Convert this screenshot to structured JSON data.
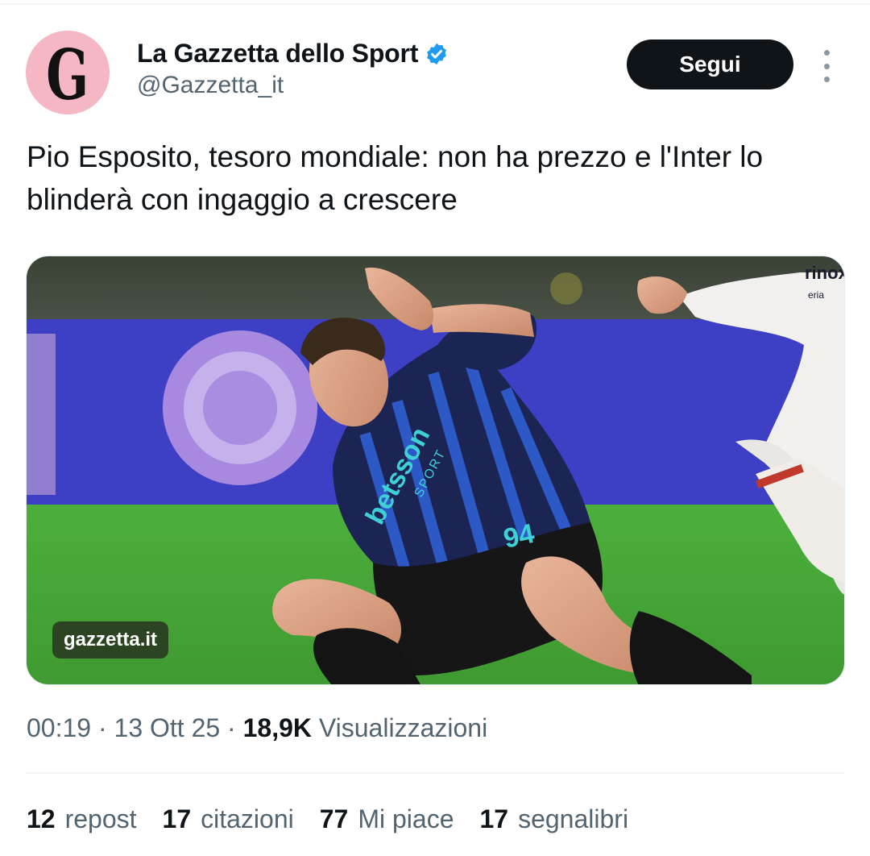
{
  "account": {
    "avatar_letter": "G",
    "display_name": "La Gazzetta dello Sport",
    "handle": "@Gazzetta_it",
    "verified": true,
    "avatar_color": "#f4b7c3",
    "verified_color": "#1d9bf0"
  },
  "actions": {
    "follow_label": "Segui",
    "more_icon": "more-vertical-icon"
  },
  "tweet": {
    "text": "Pio Esposito, tesoro mondiale: non ha prezzo e l'Inter lo blinderà con ingaggio a crescere"
  },
  "media": {
    "badge": "gazzetta.it",
    "jersey_sponsor": "betsson",
    "jersey_sponsor_sub": "SPORT",
    "jersey_number": "94",
    "opponent_sponsor": "rinox",
    "opponent_sponsor_sub": "eria"
  },
  "meta": {
    "time": "00:19",
    "date": "13 Ott 25",
    "views_count": "18,9K",
    "views_label": "Visualizzazioni",
    "separator": "·"
  },
  "stats": [
    {
      "num": "12",
      "label": "repost"
    },
    {
      "num": "17",
      "label": "citazioni"
    },
    {
      "num": "77",
      "label": "Mi piace"
    },
    {
      "num": "17",
      "label": "segnalibri"
    }
  ]
}
